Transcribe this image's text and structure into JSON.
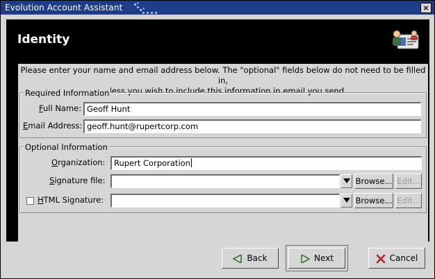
{
  "window": {
    "title": "Evolution Account Assistant",
    "close_glyph": "×"
  },
  "header": {
    "title": "Identity",
    "logo_icon": "identity-card-people-icon"
  },
  "intro": {
    "line1": "Please enter your name and email address below. The \"optional\" fields below do not need to be filled in,",
    "line2": "unless you wish to include this information in email you send."
  },
  "required": {
    "group_label": "Required Information",
    "full_name": {
      "mnemonic": "F",
      "label_rest": "ull Name:",
      "value": "Geoff Hunt"
    },
    "email": {
      "mnemonic": "E",
      "label_rest": "mail Address:",
      "value": "geoff.hunt@rupertcorp.com"
    }
  },
  "optional": {
    "group_label": "Optional Information",
    "organization": {
      "mnemonic": "O",
      "label_rest": "rganization:",
      "value": "Rupert Corporation"
    },
    "signature_file": {
      "mnemonic": "S",
      "label_rest": "ignature file:",
      "value": "",
      "browse": "Browse...",
      "edit": "Edit..."
    },
    "html_signature": {
      "mnemonic": "H",
      "label_rest": "TML Signature:",
      "checked": false,
      "value": "",
      "browse": "Browse...",
      "edit": "Edit..."
    }
  },
  "buttons": {
    "back": "Back",
    "next": "Next",
    "cancel": "Cancel"
  },
  "colors": {
    "titlebar": "#1f3c87",
    "header_bg": "#000000",
    "dialog_bg": "#d6d6d6",
    "cancel_icon": "#b22222"
  }
}
